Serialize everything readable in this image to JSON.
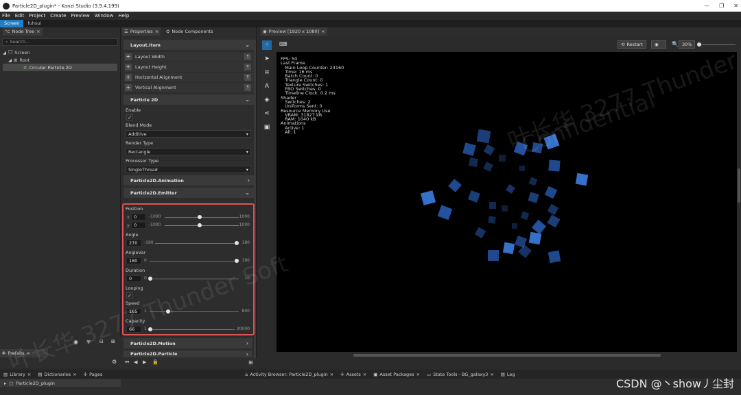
{
  "window": {
    "title": "Particle2D_plugin* - Kanzi Studio (3.9.4.199)",
    "controls": [
      "—",
      "❐",
      "✕"
    ]
  },
  "menu": [
    "File",
    "Edit",
    "Project",
    "Create",
    "Preview",
    "Window",
    "Help"
  ],
  "screen_tabs": [
    "Screen",
    "fuhsui"
  ],
  "node_tree": {
    "tab": "Node Tree",
    "search_placeholder": "Search...",
    "items": [
      {
        "label": "Screen",
        "level": 0
      },
      {
        "label": "Root",
        "level": 1
      },
      {
        "label": "Circular Particle 2D",
        "level": 2
      }
    ]
  },
  "prefabs": {
    "tab": "Prefabs"
  },
  "properties": {
    "tabs": [
      "Properties",
      "Node Components"
    ],
    "layout_item": {
      "title": "Layout.Item",
      "rows": [
        "Layout Width",
        "Layout Height",
        "Horizontal Alignment",
        "Vertical Alignment"
      ]
    },
    "particle2d": {
      "title": "Particle 2D",
      "enable_label": "Enable",
      "blend_mode_label": "Blend Mode",
      "blend_mode_value": "Additive",
      "render_type_label": "Render Type",
      "render_type_value": "Rectangle",
      "processor_type_label": "Processor Type",
      "processor_type_value": "SingleThread"
    },
    "animation_title": "Particle2D.Animation",
    "emitter": {
      "title": "Particle2D.Emitter",
      "position_label": "Position",
      "pos_x": {
        "axis": "x",
        "value": "0",
        "min": "-1000",
        "max": "1000",
        "fraction": 0.5
      },
      "pos_y": {
        "axis": "y",
        "value": "0",
        "min": "-1000",
        "max": "1000",
        "fraction": 0.5
      },
      "angle": {
        "label": "Angle",
        "value": "270",
        "min": "-180",
        "max": "180",
        "fraction": 1.0
      },
      "anglevar": {
        "label": "AngleVar",
        "value": "180",
        "min": "0",
        "max": "180",
        "fraction": 1.0
      },
      "duration": {
        "label": "Duration",
        "value": "0",
        "min": "0",
        "max": "10",
        "fraction": 0.0
      },
      "looping_label": "Looping",
      "speed": {
        "label": "Speed",
        "value": "165",
        "min": "1",
        "max": "800",
        "fraction": 0.2
      },
      "capacity": {
        "label": "Capacity",
        "value": "66",
        "min": "1",
        "max": "20000",
        "fraction": 0.003
      }
    },
    "motion_title": "Particle2D.Motion",
    "particle_title": "Particle2D.Particle"
  },
  "preview": {
    "tab": "Preview [1920 x 1080]",
    "restart_label": "Restart",
    "zoom": "30%",
    "stats": [
      "FPS: 50",
      "",
      "Last Frame",
      "   Main Loop Counter: 23160",
      "   Time: 16 ms",
      "   Batch Count: 0",
      "   Triangle Count: 0",
      "   Texture Switches: 1",
      "   FBO Switches: 0",
      "   Timeline Clock: 0.2 ms",
      "",
      "Shader",
      "   Switches: 2",
      "   Uniforms Sent: 0",
      "",
      "Resource Memory Use",
      "   VRAM: 31827 kB",
      "   RAM: 1040 kB",
      "",
      "Animations",
      "   Active: 1",
      "   All: 1"
    ]
  },
  "bottom_tabs": [
    "Library",
    "Dictionaries",
    "Pages"
  ],
  "bottom_tabs_right": [
    "Activity Browser: Particle2D_plugin",
    "Assets",
    "Asset Packages",
    "State Tools - BG_galaxy3",
    "Log"
  ],
  "library_item": "Particle2D_plugin",
  "watermark": {
    "text": "叶长华 3277 Thunder",
    "text2": "Confidential",
    "text3": "叶长华 3277 Thunder Soft"
  },
  "credit": "CSDN @丶show丿尘封"
}
